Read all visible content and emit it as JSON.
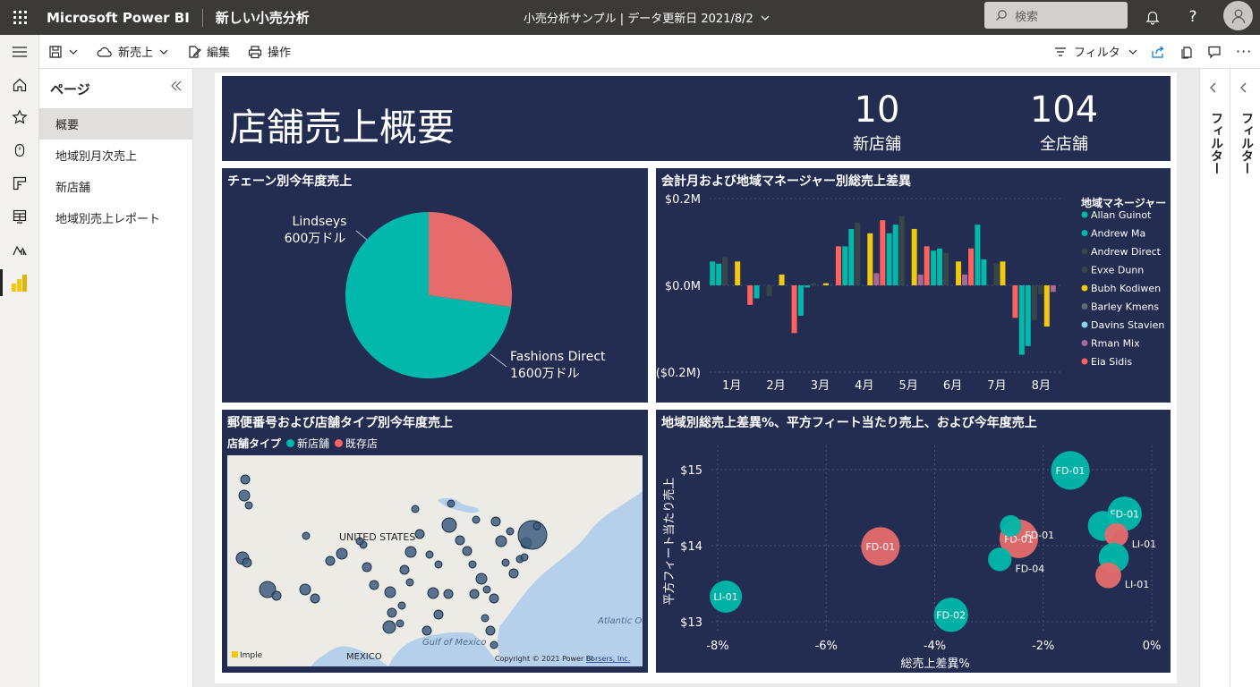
{
  "topbar": {
    "brand": "Microsoft Power BI",
    "report_name": "新しい小売分析",
    "center_title": "小売分析サンプル | データ更新日 2021/8/2",
    "search_placeholder": "検索"
  },
  "command_bar": {
    "save_label": "",
    "new_sale_label": "新売上",
    "edit_label": "編集",
    "print_label": "操作",
    "filter_label": "フィルタ"
  },
  "pages": {
    "header": "ページ",
    "items": [
      {
        "label": "概要",
        "active": true
      },
      {
        "label": "地域別月次売上",
        "active": false
      },
      {
        "label": "新店舗",
        "active": false
      },
      {
        "label": "地域別売上レポート",
        "active": false
      }
    ]
  },
  "filter_panes": {
    "inner_label": "フィルター",
    "outer_label": "フィルター"
  },
  "report": {
    "title": "店舗売上概要",
    "kpis": [
      {
        "value": "10",
        "label": "新店舗"
      },
      {
        "value": "104",
        "label": "全店舗"
      }
    ],
    "pie": {
      "title": "チェーン別今年度売上",
      "slices": [
        {
          "name": "Lindseys",
          "label_value": "600万ドル",
          "value": 6,
          "color": "#e66c6b"
        },
        {
          "name": "Fashions Direct",
          "label_value": "1600万ドル",
          "value": 16,
          "color": "#01b8aa"
        }
      ]
    },
    "bar": {
      "title": "会計月および地域マネージャー別総売上差異",
      "legend_title": "地域マネージャー",
      "yticks": [
        "$0.2M",
        "$0.0M",
        "($0.2M)"
      ],
      "months": [
        "1月",
        "2月",
        "3月",
        "4月",
        "5月",
        "6月",
        "7月",
        "8月"
      ]
    },
    "map": {
      "title": "郵便番号および店舗タイプ別今年度売上",
      "legend_title": "店舗タイプ",
      "legend_items": [
        {
          "label": "新店舗",
          "color": "#01b8aa"
        },
        {
          "label": "既存店",
          "color": "#fd625e"
        }
      ],
      "country_label": "UNITED STATES",
      "mexico_label": "MEXICO",
      "gulf_label": "Gulf of Mexico",
      "atlantic_label": "Atlantic Ocean",
      "copyright": "Copyright © 2021 Power BI",
      "terms": "Eorsers, Inc.",
      "provider": "Imple"
    },
    "scatter": {
      "title": "地域別総売上差異%、平方フィート当たり売上、および今年度売上",
      "xlabel": "総売上差異%",
      "ylabel": "平方フィート当たり売上"
    }
  },
  "chart_data": [
    {
      "type": "pie",
      "title": "チェーン別今年度売上",
      "categories": [
        "Lindseys",
        "Fashions Direct"
      ],
      "values": [
        6,
        16
      ],
      "colors": [
        "#e66c6b",
        "#01b8aa"
      ]
    },
    {
      "type": "bar",
      "title": "会計月および地域マネージャー別総売上差異",
      "categories": [
        "1月",
        "2月",
        "3月",
        "4月",
        "5月",
        "6月",
        "7月",
        "8月"
      ],
      "ylim": [
        -0.2,
        0.2
      ],
      "yticks": [
        "$0.2M",
        "$0.0M",
        "($0.2M)"
      ],
      "legend_position": "right",
      "series": [
        {
          "name": "Allan Guinot",
          "color": "#01b8aa",
          "values": [
            0.055,
            -0.03,
            -0.07,
            0.09,
            0.12,
            0.08,
            0.14,
            -0.16
          ]
        },
        {
          "name": "Andrew Ma",
          "color": "#01b8aa",
          "values": [
            0.05,
            0.0,
            -0.005,
            0.13,
            0.14,
            0.085,
            0.06,
            -0.14
          ]
        },
        {
          "name": "Andrew Direct",
          "color": "#374649",
          "values": [
            0.065,
            -0.025,
            0.005,
            0.145,
            0.16,
            0.075,
            0.0,
            -0.08
          ]
        },
        {
          "name": "Evxe Dunn",
          "color": "#374649",
          "values": [
            0.0,
            0.0,
            0.0,
            0.0,
            0.0,
            0.0,
            0.05,
            -0.02
          ]
        },
        {
          "name": "Bubh Kodiwen",
          "color": "#f2c80f",
          "values": [
            0.055,
            0.025,
            0.005,
            0.12,
            0.13,
            0.055,
            0.055,
            -0.095
          ]
        },
        {
          "name": "Barley Kmens",
          "color": "#5f6b6d",
          "values": [
            0.0,
            0.0,
            0.0,
            0.0,
            0.0,
            0.0,
            0.0,
            0.0
          ]
        },
        {
          "name": "Davins Stavien",
          "color": "#8ad4eb",
          "values": [
            0.0,
            0.0,
            0.0,
            0.0,
            0.0,
            0.0,
            0.0,
            0.0
          ]
        },
        {
          "name": "Rman Mix",
          "color": "#a66999",
          "values": [
            0.0,
            0.0,
            0.0,
            0.028,
            0.025,
            0.025,
            0.0,
            -0.015
          ]
        },
        {
          "name": "Eia Sidis",
          "color": "#fd625e",
          "values": [
            -0.045,
            -0.11,
            0.09,
            0.15,
            0.09,
            0.085,
            -0.075,
            0.0
          ]
        }
      ]
    },
    {
      "type": "scatter",
      "title": "地域別総売上差異%、平方フィート当たり売上、および今年度売上",
      "xlabel": "総売上差異%",
      "ylabel": "平方フィート当たり売上",
      "xlim": [
        -8,
        0
      ],
      "ylim": [
        13,
        15
      ],
      "xticks": [
        "-8%",
        "-6%",
        "-4%",
        "-2%",
        "0%"
      ],
      "yticks": [
        "$15",
        "$14",
        "$13"
      ],
      "points": [
        {
          "label": "FD-01",
          "x": -1.5,
          "y": 14.99,
          "size": 1.3,
          "color": "#01b8aa"
        },
        {
          "label": "FD-01",
          "x": -0.5,
          "y": 14.42,
          "size": 1.1,
          "color": "#01b8aa"
        },
        {
          "label": "",
          "x": -0.9,
          "y": 14.26,
          "size": 0.9,
          "color": "#01b8aa"
        },
        {
          "label": "LI-01",
          "x": -0.65,
          "y": 14.14,
          "size": 0.6,
          "color": "#e66c6b"
        },
        {
          "label": "",
          "x": -0.7,
          "y": 13.84,
          "size": 0.9,
          "color": "#01b8aa"
        },
        {
          "label": "LI-01",
          "x": -0.8,
          "y": 13.61,
          "size": 0.7,
          "color": "#e66c6b"
        },
        {
          "label": "FD-01",
          "x": -2.45,
          "y": 14.09,
          "size": 1.3,
          "color": "#e66c6b"
        },
        {
          "label": "FD-01",
          "x": -2.6,
          "y": 14.26,
          "size": 0.5,
          "color": "#01b8aa"
        },
        {
          "label": "FD-04",
          "x": -2.8,
          "y": 13.82,
          "size": 0.6,
          "color": "#01b8aa"
        },
        {
          "label": "FD-01",
          "x": -5.0,
          "y": 13.99,
          "size": 1.3,
          "color": "#e66c6b"
        },
        {
          "label": "FD-02",
          "x": -3.7,
          "y": 13.09,
          "size": 1.1,
          "color": "#01b8aa"
        },
        {
          "label": "LI-01",
          "x": -7.85,
          "y": 13.33,
          "size": 1.0,
          "color": "#01b8aa"
        }
      ]
    }
  ]
}
